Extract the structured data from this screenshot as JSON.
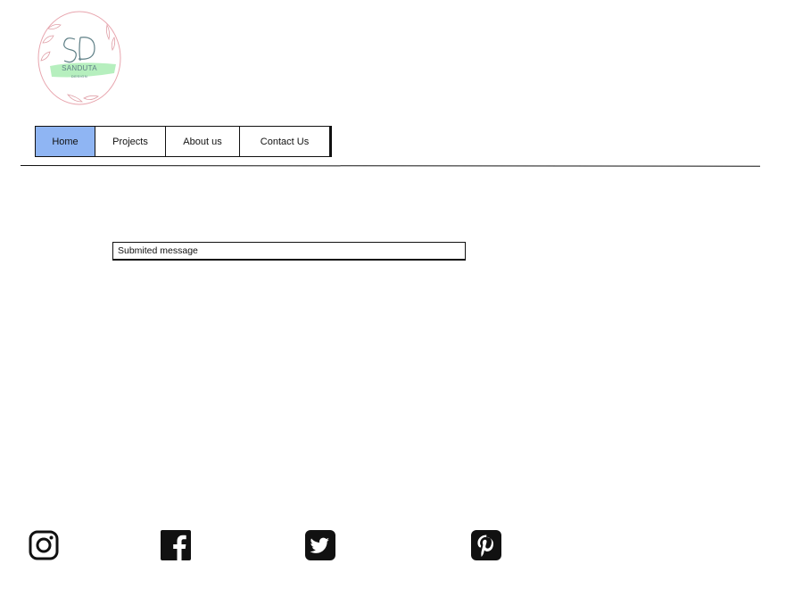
{
  "logo": {
    "monogram": "SD",
    "brand": "SANDUTA",
    "tagline": "DESIGN",
    "colors": {
      "wreath": "#e8a5ae",
      "monogram": "#5e7f86",
      "highlight": "#a9ecb3"
    }
  },
  "nav": {
    "items": [
      {
        "label": "Home",
        "active": true
      },
      {
        "label": "Projects",
        "active": false
      },
      {
        "label": "About us",
        "active": false
      },
      {
        "label": "Contact Us",
        "active": false
      }
    ],
    "active_color": "#8fb5f3"
  },
  "main": {
    "message": "Submited message"
  },
  "footer": {
    "social": [
      {
        "icon": "instagram-icon"
      },
      {
        "icon": "facebook-icon"
      },
      {
        "icon": "twitter-icon"
      },
      {
        "icon": "pinterest-icon"
      }
    ]
  }
}
